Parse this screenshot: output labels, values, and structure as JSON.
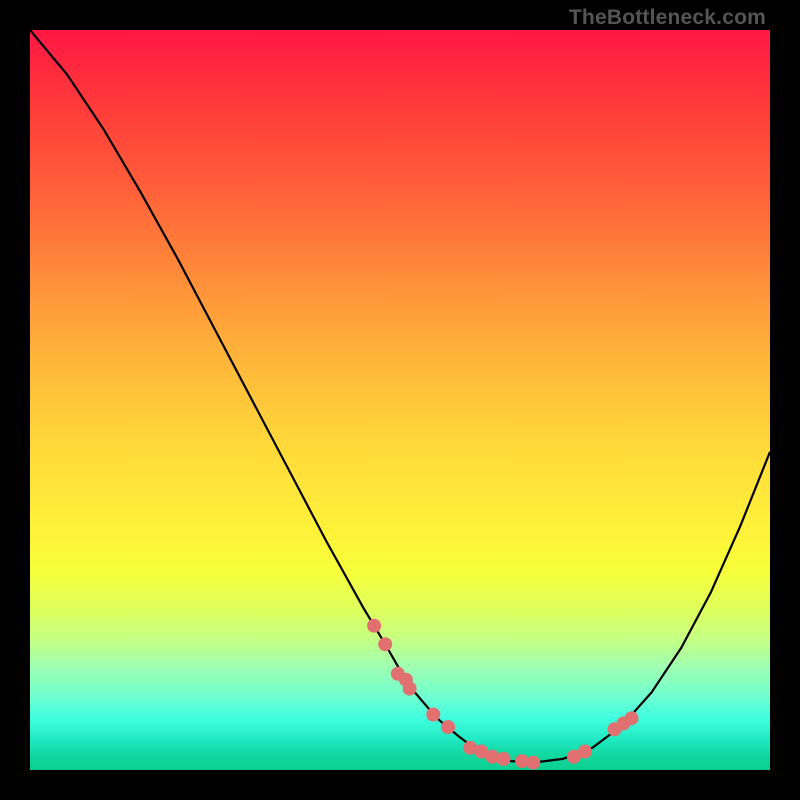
{
  "watermark": "TheBottleneck.com",
  "chart_data": {
    "type": "line",
    "title": "",
    "xlabel": "",
    "ylabel": "",
    "xlim": [
      0,
      100
    ],
    "ylim": [
      0,
      100
    ],
    "series": [
      {
        "name": "curve",
        "x": [
          0,
          5,
          10,
          15,
          20,
          25,
          30,
          35,
          40,
          45,
          48,
          50,
          52,
          55,
          58,
          60,
          63,
          65,
          68,
          72,
          76,
          80,
          84,
          88,
          92,
          96,
          100
        ],
        "y": [
          100,
          94,
          86.5,
          78,
          69,
          59.5,
          50,
          40.5,
          31,
          22,
          17,
          13.5,
          10.5,
          7,
          4.5,
          3,
          1.8,
          1.2,
          1,
          1.5,
          3,
          6,
          10.5,
          16.5,
          24,
          33,
          43
        ]
      }
    ],
    "points": {
      "name": "dots",
      "x": [
        46.5,
        48,
        49.7,
        50.8,
        51.3,
        54.5,
        56.5,
        59.5,
        61,
        62.5,
        64,
        66.5,
        68,
        73.5,
        75,
        79,
        80.2,
        81.3
      ],
      "y": [
        19.5,
        17,
        13,
        12.2,
        11,
        7.5,
        5.8,
        3,
        2.5,
        1.8,
        1.5,
        1.2,
        1,
        1.8,
        2.5,
        5.5,
        6.3,
        7
      ]
    }
  }
}
